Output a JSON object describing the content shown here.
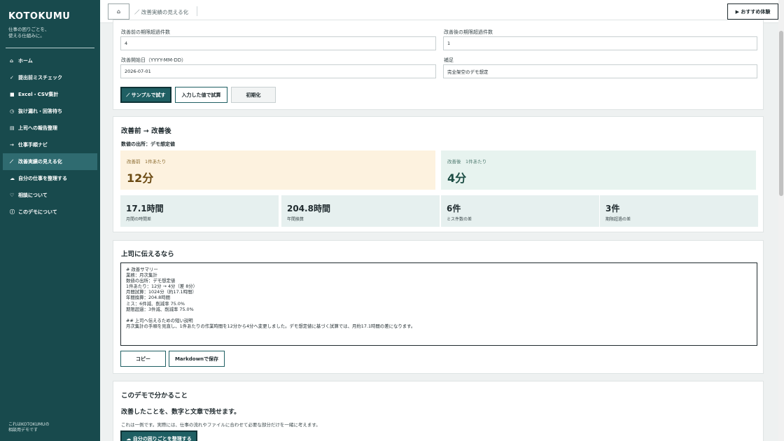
{
  "sidebar": {
    "brand": "KOTOKUMU",
    "tagline": "仕事の困りごとを、\n使える仕組みに。",
    "items": [
      {
        "icon": "⌂",
        "label": "ホーム"
      },
      {
        "icon": "✓",
        "label": "提出前ミスチェック"
      },
      {
        "icon": "■",
        "label": "Excel・CSV集計"
      },
      {
        "icon": "◷",
        "label": "抜け漏れ・回答待ち"
      },
      {
        "icon": "▤",
        "label": "上司への報告整理"
      },
      {
        "icon": "→",
        "label": "仕事手順ナビ"
      },
      {
        "icon": "⟋",
        "label": "改善実績の見える化"
      },
      {
        "icon": "☁",
        "label": "自分の仕事を整理する"
      },
      {
        "icon": "♡",
        "label": "相談について"
      },
      {
        "icon": "ⓘ",
        "label": "このデモについて"
      }
    ],
    "footer": "これはKOTOKUMUの\n相談用デモです"
  },
  "topbar": {
    "home_icon": "⌂",
    "breadcrumb": "／ 改善実績の見える化",
    "demo_button": "▶ おすすめ体験"
  },
  "form": {
    "before_overdue_label": "改善前の期限超過件数",
    "before_overdue_value": "4",
    "after_overdue_label": "改善後の期限超過件数",
    "after_overdue_value": "1",
    "start_date_label": "改善開始日（YYYY-MM-DD）",
    "start_date_value": "2026-07-01",
    "note_label": "補足",
    "note_value": "完全架空のデモ想定",
    "sample_button": "⟋ サンプルで試す",
    "calc_button": "入力した値で試算",
    "reset_button": "初期化"
  },
  "result": {
    "title": "改善前 → 改善後",
    "source": "数値の出所：デモ想定値",
    "before_label": "改善前　1件あたり",
    "before_value": "12分",
    "after_label": "改善後　1件あたり",
    "after_value": "4分",
    "stats": [
      {
        "value": "17.1時間",
        "label": "月間の時間差"
      },
      {
        "value": "204.8時間",
        "label": "年間換算"
      },
      {
        "value": "6件",
        "label": "ミス件数の差"
      },
      {
        "value": "3件",
        "label": "期限超過の差"
      }
    ]
  },
  "report": {
    "title": "上司に伝えるなら",
    "summary": "# 改善サマリー\n業務：月次集計\n数値の出所：デモ想定値\n1件あたり：12分 → 4分（差 8分）\n月間試算：1024分（約17.1時間）\n年間換算：204.8時間\nミス：6件減、削減率 75.0%\n期限超過：3件減、削減率 75.0%\n\n## 上司へ伝えるための短い説明\n月次集計の手順を見直し、1件あたりの作業時間を12分から4分へ変更しました。デモ想定値に基づく試算では、月約17.1時間の差になります。",
    "copy_button": "コピー",
    "save_button": "Markdownで保存"
  },
  "about": {
    "title": "このデモで分かること",
    "lead": "改善したことを、数字と文章で残せます。",
    "desc": "これは一例です。実際には、仕事の流れやファイルに合わせて必要な部分だけを一緒に考えます。",
    "cta_button": "☁ 自分の困りごとを整理する"
  }
}
